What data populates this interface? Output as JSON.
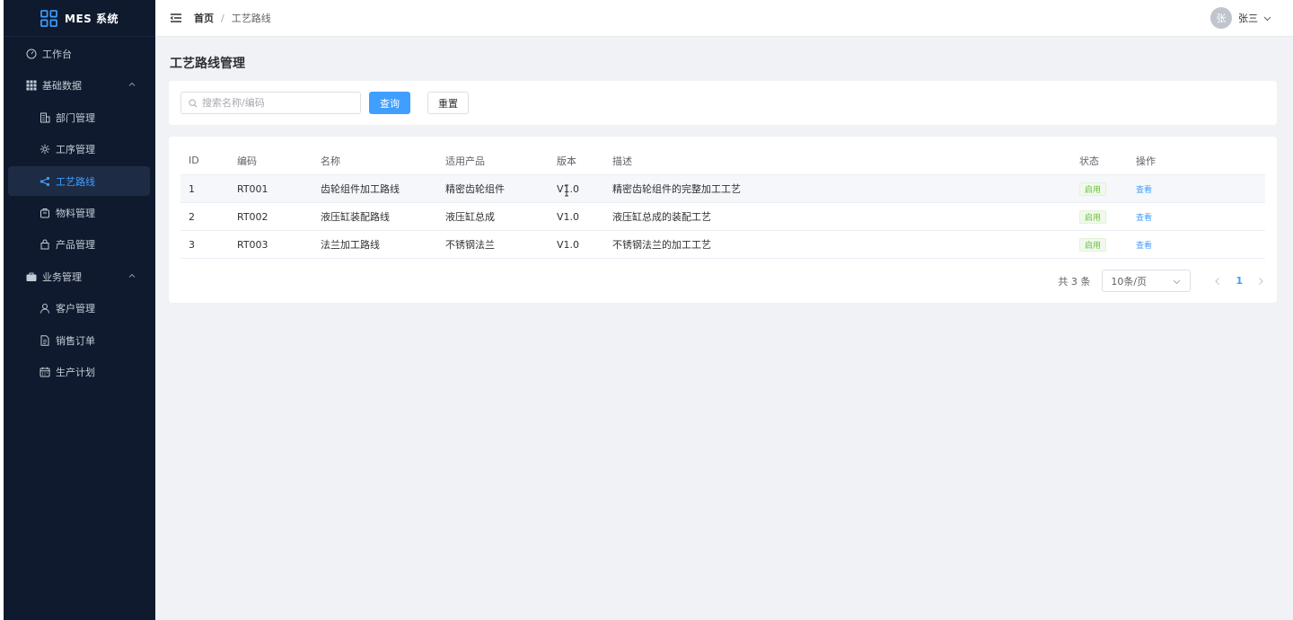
{
  "app": {
    "title": "MES 系统"
  },
  "sidebar": {
    "items": [
      {
        "label": "工作台",
        "icon": "dashboard-icon"
      },
      {
        "label": "基础数据",
        "icon": "grid-icon",
        "expanded": true
      },
      {
        "label": "部门管理",
        "icon": "building-icon"
      },
      {
        "label": "工序管理",
        "icon": "gear-icon"
      },
      {
        "label": "工艺路线",
        "icon": "share-icon",
        "active": true
      },
      {
        "label": "物料管理",
        "icon": "box-icon"
      },
      {
        "label": "产品管理",
        "icon": "bag-icon"
      },
      {
        "label": "业务管理",
        "icon": "briefcase-icon",
        "expanded": true
      },
      {
        "label": "客户管理",
        "icon": "user-icon"
      },
      {
        "label": "销售订单",
        "icon": "document-icon"
      },
      {
        "label": "生产计划",
        "icon": "calendar-icon"
      }
    ]
  },
  "header": {
    "breadcrumb": {
      "home": "首页",
      "separator": "/",
      "current": "工艺路线"
    },
    "user": {
      "avatar_text": "张",
      "name": "张三"
    }
  },
  "page": {
    "title": "工艺路线管理"
  },
  "search": {
    "placeholder": "搜索名称/编码",
    "value": "",
    "query_label": "查询",
    "reset_label": "重置"
  },
  "table": {
    "columns": [
      "ID",
      "编码",
      "名称",
      "适用产品",
      "版本",
      "描述",
      "状态",
      "操作"
    ],
    "rows": [
      {
        "id": "1",
        "code": "RT001",
        "name": "齿轮组件加工路线",
        "product": "精密齿轮组件",
        "version": "V1.0",
        "desc": "精密齿轮组件的完整加工工艺",
        "status": "启用",
        "action": "查看"
      },
      {
        "id": "2",
        "code": "RT002",
        "name": "液压缸装配路线",
        "product": "液压缸总成",
        "version": "V1.0",
        "desc": "液压缸总成的装配工艺",
        "status": "启用",
        "action": "查看"
      },
      {
        "id": "3",
        "code": "RT003",
        "name": "法兰加工路线",
        "product": "不锈钢法兰",
        "version": "V1.0",
        "desc": "不锈钢法兰的加工工艺",
        "status": "启用",
        "action": "查看"
      }
    ]
  },
  "pagination": {
    "total": "共 3 条",
    "page_size": "10条/页",
    "current_page": "1"
  },
  "colors": {
    "sidebar_bg": "#0f1a2e",
    "accent": "#409eff",
    "success": "#67c23a",
    "main_bg": "#f0f2f5"
  }
}
